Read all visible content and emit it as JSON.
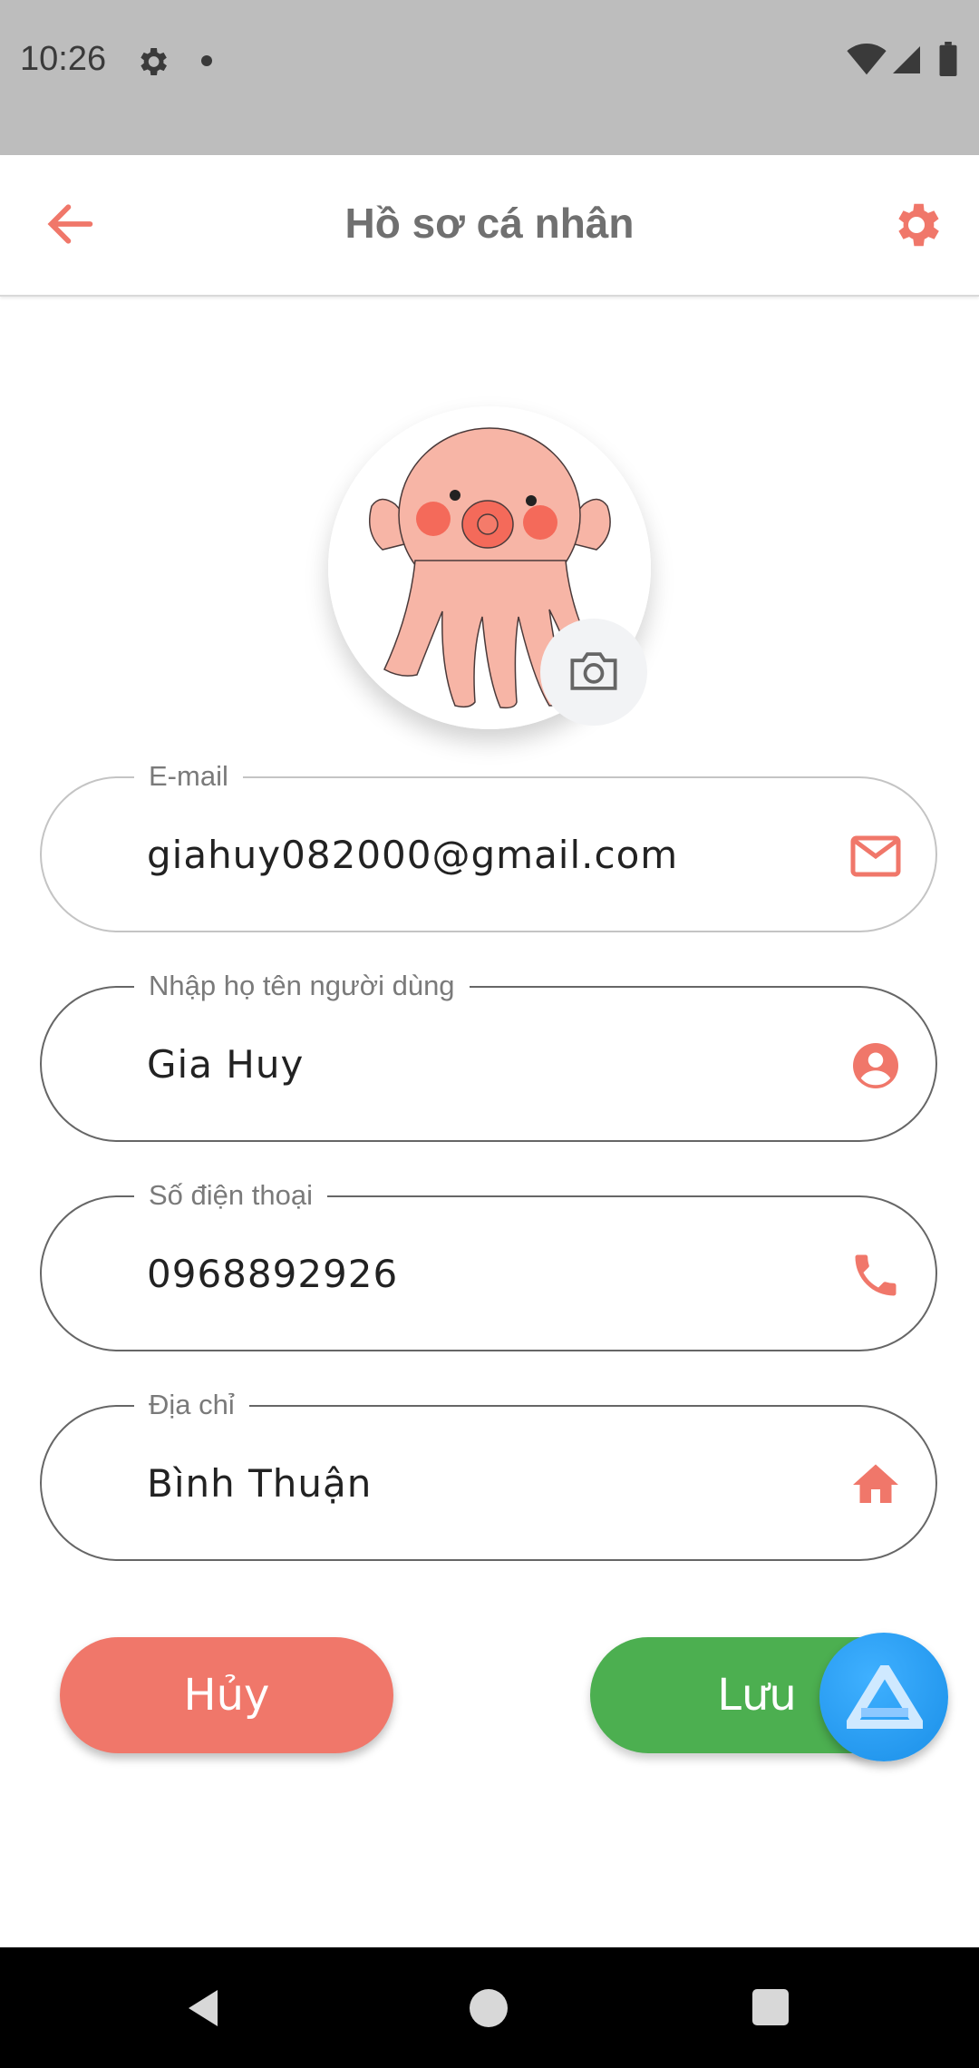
{
  "status_bar": {
    "time": "10:26",
    "icons": [
      "gear-icon",
      "notification-dot",
      "wifi-icon",
      "signal-icon",
      "battery-icon"
    ]
  },
  "app_bar": {
    "title": "Hồ sơ cá nhân",
    "back_icon": "arrow-left-icon",
    "settings_icon": "gear-icon"
  },
  "avatar": {
    "image": "octopus-illustration",
    "change_icon": "camera-icon"
  },
  "form": {
    "email": {
      "label": "E-mail",
      "value": "giahuy082000@gmail.com",
      "icon": "mail-icon"
    },
    "name": {
      "label": "Nhập họ tên người dùng",
      "value": "Gia Huy",
      "icon": "account-circle-icon"
    },
    "phone": {
      "label": "Số điện thoại",
      "value": "0968892926",
      "icon": "phone-icon"
    },
    "address": {
      "label": "Địa chỉ",
      "value": "Bình Thuận",
      "icon": "home-icon"
    }
  },
  "actions": {
    "cancel_label": "Hủy",
    "save_label": "Lưu"
  },
  "colors": {
    "accent": "#f0776a",
    "save": "#4caf50",
    "fab": "#1a8fe8",
    "status_bar": "#bdbdbd"
  },
  "nav_bar": {
    "icons": [
      "nav-back-icon",
      "nav-home-icon",
      "nav-recents-icon"
    ]
  }
}
